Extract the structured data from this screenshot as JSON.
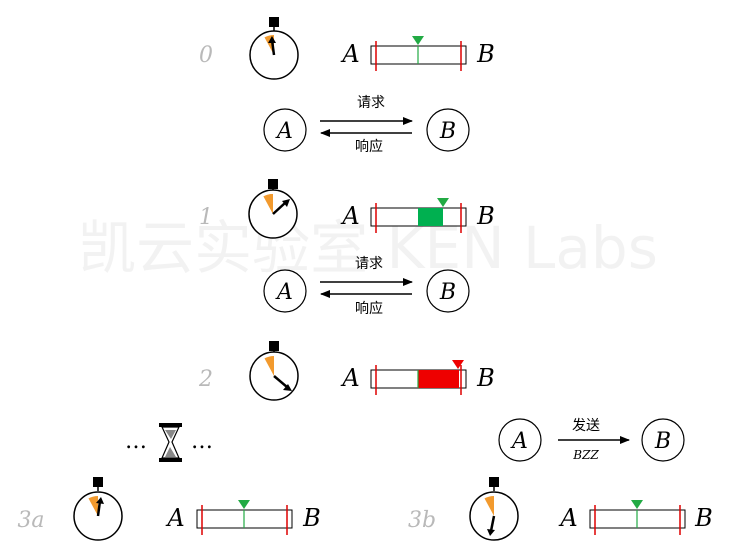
{
  "watermark": "凯云实验室 KEN Labs",
  "endpoint_a": "A",
  "endpoint_b": "B",
  "messages": {
    "request": "请求",
    "response": "响应",
    "send": "发送",
    "bzz": "BZZ"
  },
  "ellipsis": "…",
  "steps": [
    {
      "label": "0",
      "timer_level": 0.0,
      "window_state": "idle"
    },
    {
      "label": "1",
      "timer_level": 0.4,
      "window_state": "pending"
    },
    {
      "label": "2",
      "timer_level": 1.0,
      "window_state": "expired"
    },
    {
      "label": "3a",
      "timer_level": 0.0,
      "window_state": "idle"
    },
    {
      "label": "3b",
      "timer_level": 0.0,
      "window_state": "idle"
    }
  ],
  "colors": {
    "marker_green": "#22aa44",
    "fill_green": "#00b050",
    "fill_red": "#ee0000",
    "boundary_red": "#dd0000",
    "timer_orange": "#f29a2e",
    "step_gray": "#b9b9b9"
  }
}
